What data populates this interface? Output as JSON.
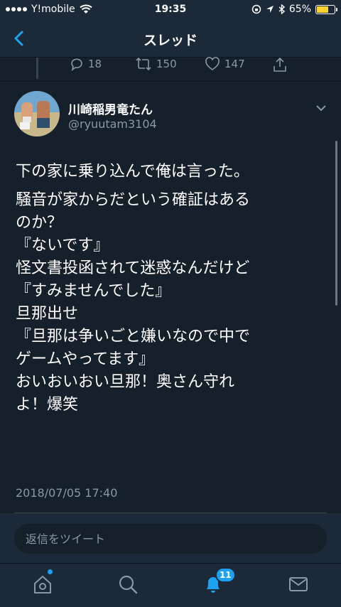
{
  "status_bar": {
    "carrier": "Y!mobile",
    "time": "19:35",
    "battery": "65%",
    "battery_level": 0.65
  },
  "nav": {
    "title": "スレッド"
  },
  "previous_tweet_actions": {
    "replies": "18",
    "retweets": "150",
    "likes": "147"
  },
  "tweet": {
    "author_name": "川崎稲男竜たん",
    "handle": "@ryuutam3104",
    "lines": [
      "下の家に乗り込んで俺は言った。",
      "騒音が家からだという確証はある",
      "のか？",
      "『ないです』",
      "怪文書投函されて迷惑なんだけど",
      "『すみませんでした』",
      "旦那出せ",
      "『旦那は争いごと嫌いなので中で",
      "ゲームやってます』",
      "おいおいおい旦那！奥さん守れ",
      "よ！爆笑"
    ],
    "timestamp": "2018/07/05 17:40"
  },
  "reply": {
    "placeholder": "返信をツイート"
  },
  "tabbar": {
    "notifications_badge": "11"
  },
  "colors": {
    "background": "#15202b",
    "bar": "#1c2938",
    "accent": "#1da1f2",
    "secondary_text": "#8899a6",
    "battery": "#ffd22e"
  }
}
